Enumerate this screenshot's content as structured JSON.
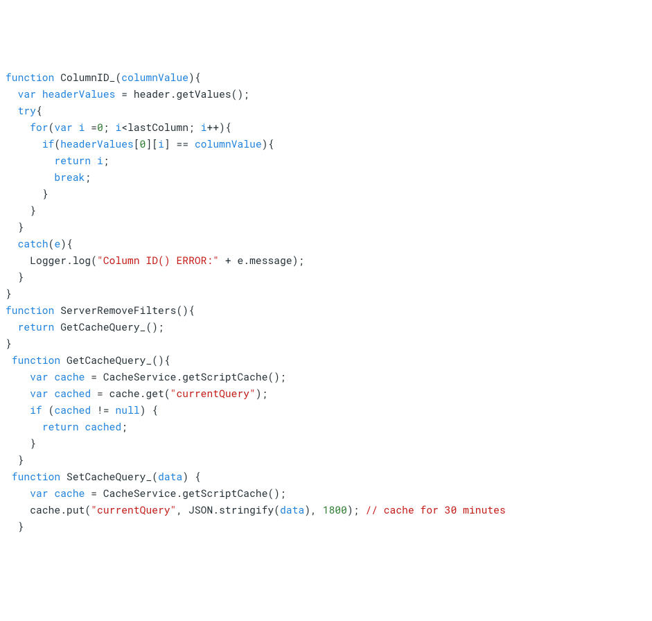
{
  "code": {
    "fn1_name": "ColumnID_",
    "fn1_param": "columnValue",
    "var_headerValues": "headerValues",
    "assign_headerValues": " = header.getValues();",
    "kw_function": "function",
    "kw_var": "var",
    "kw_try": "try",
    "kw_for": "for",
    "kw_if": "if",
    "kw_return": "return",
    "kw_break": "break",
    "kw_catch": "catch",
    "kw_null": "null",
    "for_init_i": "i",
    "for_init_eq": " =",
    "for_init_zero": "0",
    "for_cond_i": "i",
    "for_cond_rest": "<lastColumn; ",
    "for_inc_i": "i",
    "for_inc_op": "++){",
    "if_hv": "headerValues",
    "if_idx0": "0",
    "if_i": "i",
    "if_cmp": " == ",
    "if_cv": "columnValue",
    "return_i": "i",
    "semicolon": ";",
    "catch_e": "e",
    "logger_call": "Logger.log(",
    "err_str": "\"Column ID() ERROR:\"",
    "err_concat": " + e.message);",
    "fn2_name": "ServerRemoveFilters",
    "fn2_body_return": " GetCacheQuery_();",
    "fn3_name": "GetCacheQuery_",
    "cache_var": "cache",
    "cache_assign": " = CacheService.getScriptCache();",
    "cached_var": "cached",
    "cached_assign_pre": " = cache.get(",
    "currentQuery_str": "\"currentQuery\"",
    "cached_assign_post": ");",
    "if_cached": "cached",
    "if_nenull": " != ",
    "return_cached": "cached",
    "fn4_name": "SetCacheQuery_",
    "fn4_param": "data",
    "cache_put_pre": "cache.put(",
    "cache_put_mid": ", JSON.stringify(",
    "cache_put_data": "data",
    "cache_put_after": "), ",
    "cache_put_num": "1800",
    "cache_put_end": "); ",
    "cache_put_cmt": "// cache for 30 minutes"
  }
}
